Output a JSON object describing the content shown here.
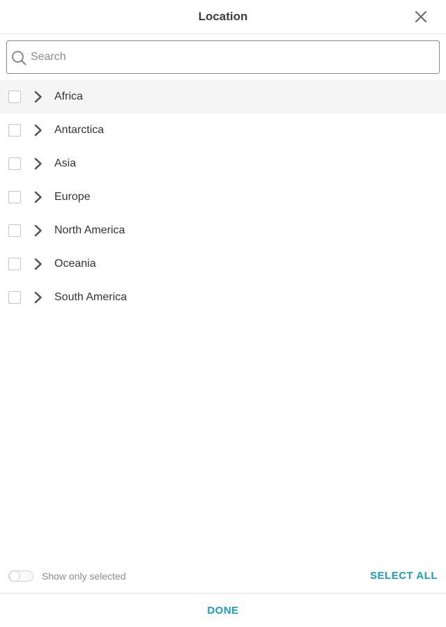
{
  "header": {
    "title": "Location",
    "close_icon": "close-icon"
  },
  "search": {
    "placeholder": "Search",
    "value": "",
    "icon": "search-icon"
  },
  "list": {
    "items": [
      {
        "label": "Africa",
        "checked": false
      },
      {
        "label": "Antarctica",
        "checked": false
      },
      {
        "label": "Asia",
        "checked": false
      },
      {
        "label": "Europe",
        "checked": false
      },
      {
        "label": "North America",
        "checked": false
      },
      {
        "label": "Oceania",
        "checked": false
      },
      {
        "label": "South America",
        "checked": false
      }
    ]
  },
  "footer": {
    "toggle_label": "Show only selected",
    "toggle_on": false,
    "select_all_label": "Select all",
    "done_label": "Done"
  },
  "colors": {
    "accent": "#1a9cc0",
    "divider": "#e3e3e3",
    "hover_row": "#f5f5f5"
  }
}
